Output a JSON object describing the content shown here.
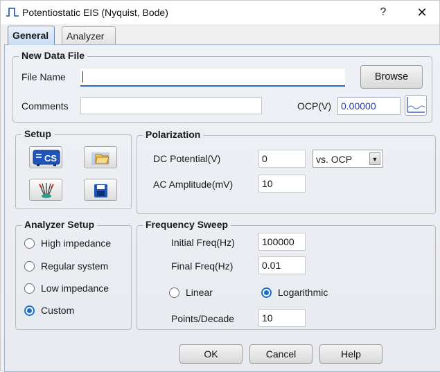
{
  "window": {
    "title": "Potentiostatic EIS (Nyquist, Bode)",
    "help_label": "?",
    "close_label": "✕"
  },
  "tabs": [
    {
      "label": "General",
      "active": true
    },
    {
      "label": "Analyzer",
      "active": false
    }
  ],
  "new_data_file": {
    "title": "New Data File",
    "file_name_label": "File Name",
    "file_name_value": "",
    "browse_label": "Browse",
    "comments_label": "Comments",
    "comments_value": "",
    "ocp_label": "OCP(V)",
    "ocp_value": "0.00000",
    "ocp_chart_icon": "waveform-chart-icon"
  },
  "setup": {
    "title": "Setup",
    "icons": [
      "cs-instrument-icon",
      "open-folder-icon",
      "electrode-cell-icon",
      "save-disk-icon"
    ],
    "cs_text": "CS"
  },
  "polarization": {
    "title": "Polarization",
    "dc_potential_label": "DC Potential(V)",
    "dc_potential_value": "0",
    "reference_selected": "vs. OCP",
    "ac_amplitude_label": "AC Amplitude(mV)",
    "ac_amplitude_value": "10"
  },
  "analyzer_setup": {
    "title": "Analyzer Setup",
    "options": [
      {
        "label": "High impedance",
        "selected": false
      },
      {
        "label": "Regular system",
        "selected": false
      },
      {
        "label": "Low impedance",
        "selected": false
      },
      {
        "label": "Custom",
        "selected": true
      }
    ]
  },
  "frequency_sweep": {
    "title": "Frequency Sweep",
    "initial_label": "Initial Freq(Hz)",
    "initial_value": "100000",
    "final_label": "Final Freq(Hz)",
    "final_value": "0.01",
    "linear_label": "Linear",
    "linear_selected": false,
    "log_label": "Logarithmic",
    "log_selected": true,
    "points_label": "Points/Decade",
    "points_value": "10"
  },
  "buttons": {
    "ok": "OK",
    "cancel": "Cancel",
    "help": "Help"
  },
  "colors": {
    "accent_blue": "#1a6fc9",
    "ocp_text": "#2438b5"
  }
}
